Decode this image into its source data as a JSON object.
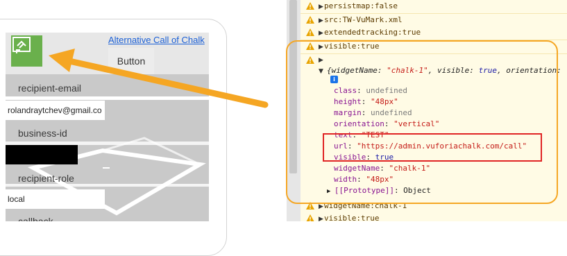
{
  "app": {
    "link_text": "Alternative Call of Chalk",
    "button_label": "Button",
    "fields": [
      {
        "label": "recipient-email",
        "value": "rolandraytchev@gmail.co"
      },
      {
        "label": "business-id",
        "value": ""
      },
      {
        "label": "recipient-role",
        "value": "local"
      },
      {
        "label": "callback",
        "value": ""
      }
    ]
  },
  "console": {
    "rows": [
      {
        "text": "persistmap:false"
      },
      {
        "text": "src:TW-VuMark.xml"
      },
      {
        "text": "extendedtracking:true"
      },
      {
        "text": "visible:true"
      }
    ],
    "expanded": {
      "summary_prefix": "{widgetName: ",
      "summary_name": "\"chalk-1\"",
      "summary_mid": ", visible: ",
      "summary_visible": "true",
      "summary_tail": ", orientation:",
      "info_badge": "i",
      "props": [
        {
          "key": "class",
          "value": "undefined",
          "kind": "undef"
        },
        {
          "key": "height",
          "value": "\"48px\"",
          "kind": "str"
        },
        {
          "key": "margin",
          "value": "undefined",
          "kind": "undef"
        },
        {
          "key": "orientation",
          "value": "\"vertical\"",
          "kind": "str"
        },
        {
          "key": "text",
          "value": "\"TEST\"",
          "kind": "str"
        },
        {
          "key": "url",
          "value": "\"https://admin.vuforiachalk.com/call\"",
          "kind": "str"
        },
        {
          "key": "visible",
          "value": "true",
          "kind": "kw"
        },
        {
          "key": "widgetName",
          "value": "\"chalk-1\"",
          "kind": "str"
        },
        {
          "key": "width",
          "value": "\"48px\"",
          "kind": "str"
        }
      ],
      "prototype": "[[Prototype]]",
      "prototype_value": ": Object"
    },
    "bottom_rows": [
      {
        "text": "widgetName:chalk-1"
      },
      {
        "text": "visible:true"
      }
    ]
  },
  "colors": {
    "annotation_orange": "#f5a623",
    "highlight_red": "#e02424",
    "chalk_green": "#6ab04c",
    "warning_bg": "#fffbe5"
  },
  "icons": [
    "chalk-logo-icon",
    "warning-icon",
    "expand-triangle-icon",
    "info-icon",
    "arrow-annotation"
  ]
}
